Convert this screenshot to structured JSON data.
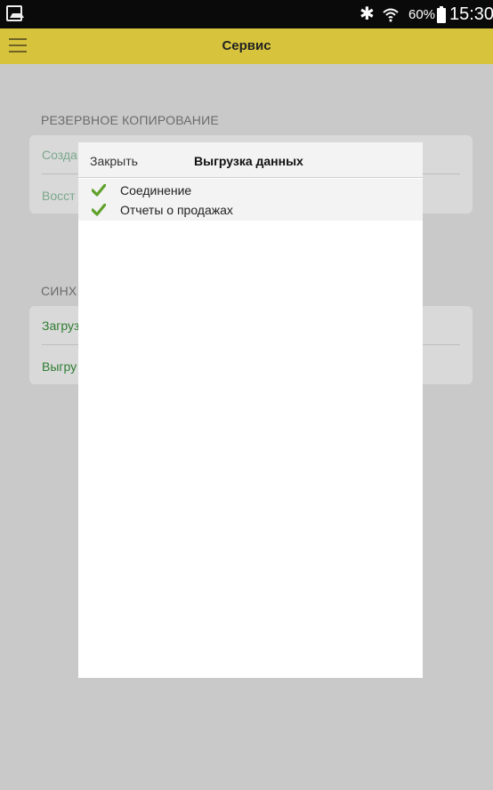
{
  "status_bar": {
    "battery_percent": "60%",
    "time": "15:30",
    "icons": [
      "gallery-icon",
      "bluetooth-icon",
      "wifi-icon",
      "battery-icon"
    ]
  },
  "app_bar": {
    "title": "Сервис",
    "background_color": "#d8c43c"
  },
  "backup": {
    "section_title": "РЕЗЕРВНОЕ КОПИРОВАНИЕ",
    "items": [
      {
        "label": "Созда"
      },
      {
        "label": "Восст"
      }
    ]
  },
  "sync": {
    "section_title": "СИНХ",
    "items": [
      {
        "label": "Загруз"
      },
      {
        "label": "Выгру"
      }
    ]
  },
  "dialog": {
    "close_label": "Закрыть",
    "title": "Выгрузка данных",
    "steps": [
      {
        "label": "Соединение",
        "status": "done"
      },
      {
        "label": "Отчеты о продажах",
        "status": "done"
      }
    ],
    "check_color": "#5fa12b"
  }
}
